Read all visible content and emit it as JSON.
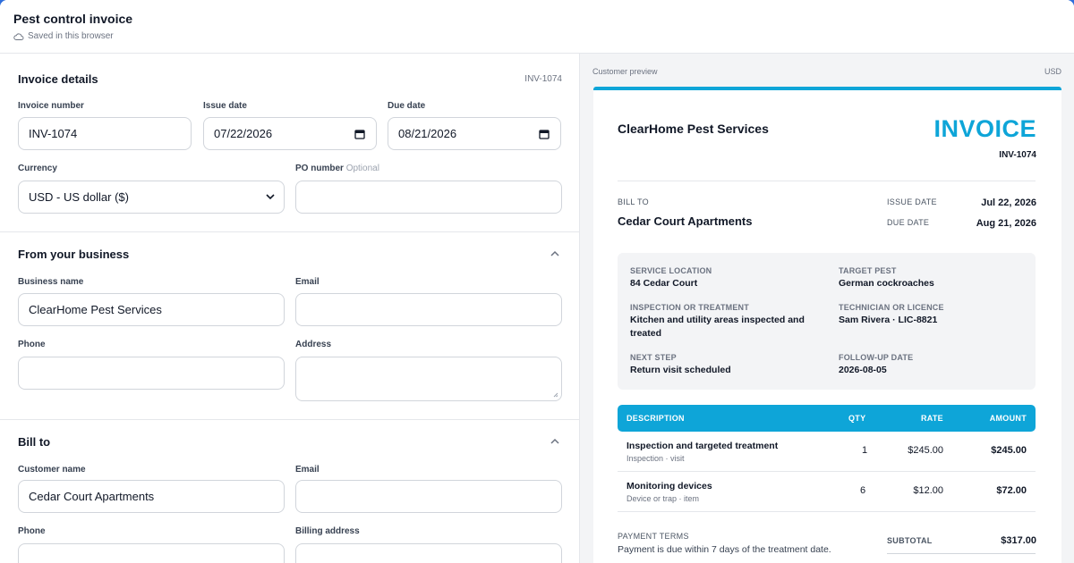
{
  "app": {
    "title": "Pest control invoice",
    "saved_status": "Saved in this browser"
  },
  "invoice_details": {
    "title": "Invoice details",
    "reference": "INV-1074",
    "invoice_number_label": "Invoice number",
    "invoice_number": "INV-1074",
    "issue_date_label": "Issue date",
    "issue_date": "07/22/2026",
    "due_date_label": "Due date",
    "due_date": "08/21/2026",
    "currency_label": "Currency",
    "currency": "USD - US dollar ($)",
    "po_label": "PO number",
    "po_optional": "Optional",
    "po_value": ""
  },
  "from_business": {
    "title": "From your business",
    "business_name_label": "Business name",
    "business_name": "ClearHome Pest Services",
    "email_label": "Email",
    "email": "",
    "phone_label": "Phone",
    "phone": "",
    "address_label": "Address",
    "address": ""
  },
  "bill_to": {
    "title": "Bill to",
    "customer_name_label": "Customer name",
    "customer_name": "Cedar Court Apartments",
    "email_label": "Email",
    "email": "",
    "phone_label": "Phone",
    "billing_address_label": "Billing address"
  },
  "preview": {
    "label": "Customer preview",
    "currency": "USD",
    "business_name": "ClearHome Pest Services",
    "invoice_word": "INVOICE",
    "invoice_number": "INV-1074",
    "bill_to_label": "BILL TO",
    "customer": "Cedar Court Apartments",
    "issue_date_label": "ISSUE DATE",
    "issue_date": "Jul 22, 2026",
    "due_date_label": "DUE DATE",
    "due_date": "Aug 21, 2026",
    "service": {
      "location_label": "SERVICE LOCATION",
      "location": "84 Cedar Court",
      "pest_label": "TARGET PEST",
      "pest": "German cockroaches",
      "inspection_label": "INSPECTION OR TREATMENT",
      "inspection_line1": "Kitchen and utility areas inspected and",
      "inspection_line2": "treated",
      "technician_label": "TECHNICIAN OR LICENCE",
      "technician": "Sam Rivera · LIC-8821",
      "next_step_label": "NEXT STEP",
      "next_step": "Return visit scheduled",
      "followup_label": "FOLLOW-UP DATE",
      "followup": "2026-08-05"
    },
    "table": {
      "headers": [
        "DESCRIPTION",
        "QTY",
        "RATE",
        "AMOUNT"
      ],
      "rows": [
        {
          "name": "Inspection and targeted treatment",
          "sub": "Inspection · visit",
          "qty": "1",
          "rate": "$245.00",
          "amount": "$245.00"
        },
        {
          "name": "Monitoring devices",
          "sub": "Device or trap · item",
          "qty": "6",
          "rate": "$12.00",
          "amount": "$72.00"
        }
      ]
    },
    "payment_terms_label": "PAYMENT TERMS",
    "payment_terms": "Payment is due within 7 days of the treatment date.",
    "subtotal_label": "SUBTOTAL",
    "subtotal": "$317.00"
  },
  "colors": {
    "accent": "#0ea5d8",
    "frame": "#2f6fdc",
    "panel_bg": "#f3f4f6"
  }
}
